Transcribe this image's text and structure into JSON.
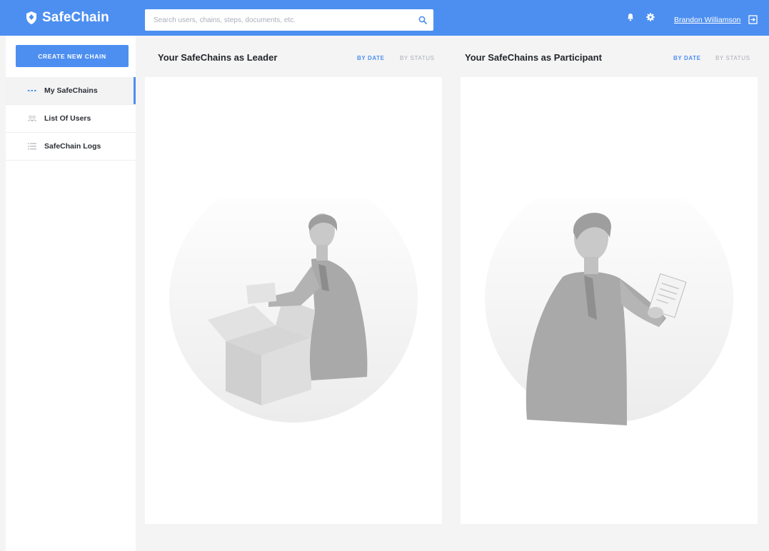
{
  "header": {
    "brand": "SafeChain",
    "search_placeholder": "Search users, chains, steps, documents, etc.",
    "user_name": "Brandon Williamson",
    "icons": [
      "shield-icon",
      "search-icon",
      "bell-icon",
      "gear-icon",
      "logout-icon"
    ]
  },
  "sidebar": {
    "create_label": "CREATE NEW CHAIN",
    "items": [
      {
        "label": "My SafeChains",
        "icon": "dots-icon",
        "active": true
      },
      {
        "label": "List Of Users",
        "icon": "users-icon",
        "active": false
      },
      {
        "label": "SafeChain Logs",
        "icon": "list-icon",
        "active": false
      }
    ]
  },
  "panels": {
    "leader": {
      "title": "Your SafeChains as Leader",
      "tab_date": "BY DATE",
      "tab_status": "BY STATUS"
    },
    "participant": {
      "title": "Your SafeChains as Participant",
      "tab_date": "BY DATE",
      "tab_status": "BY STATUS"
    }
  },
  "colors": {
    "accent": "#4d8ff0",
    "background": "#f4f4f5",
    "card": "#ffffff"
  }
}
